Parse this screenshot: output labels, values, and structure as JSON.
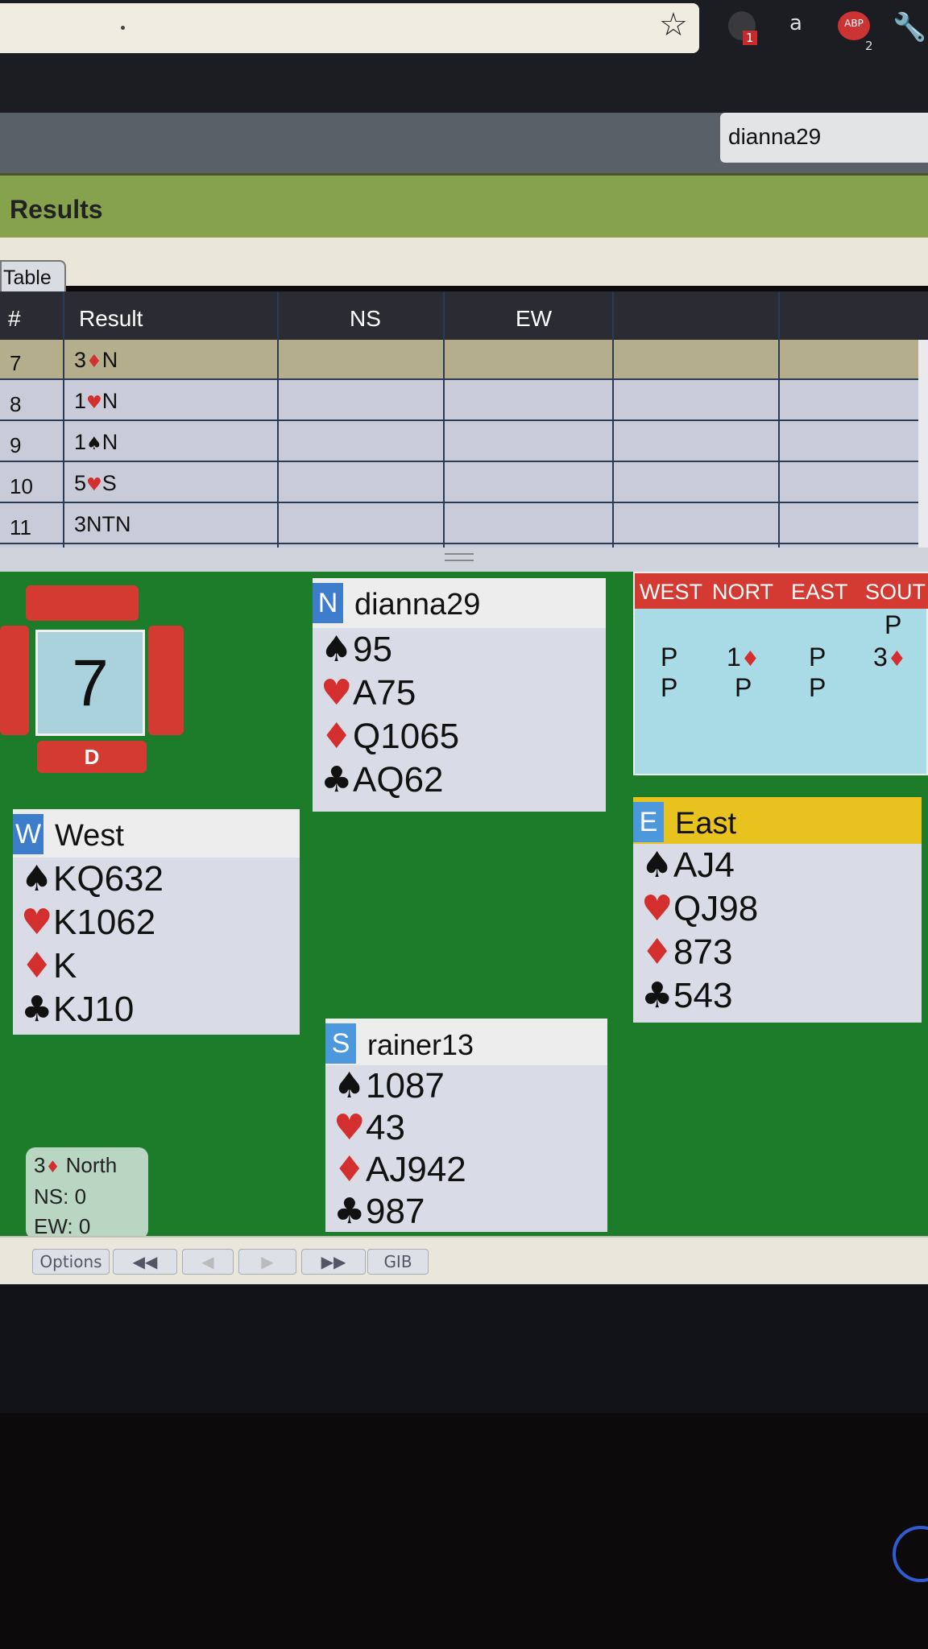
{
  "browser": {
    "bookmark_icon": "star-icon",
    "ext2_label": "a",
    "ext1_badge": "1",
    "ext3_label": "ABP",
    "ext3_count": "2"
  },
  "header": {
    "username": "dianna29",
    "section_title": "Results"
  },
  "tabs": [
    {
      "label": "Table"
    }
  ],
  "results": {
    "columns": [
      "#",
      "Result",
      "NS",
      "EW"
    ],
    "rows": [
      {
        "num": "7",
        "result": "3♦N"
      },
      {
        "num": "8",
        "result": "1♥N"
      },
      {
        "num": "9",
        "result": "1♠N"
      },
      {
        "num": "10",
        "result": "5♥S"
      },
      {
        "num": "11",
        "result": "3NTN"
      }
    ],
    "selected_row": "7"
  },
  "board": {
    "number": "7",
    "dealer": "D"
  },
  "hands": {
    "north": {
      "seat": "N",
      "name": "dianna29",
      "spades": "95",
      "hearts": "A75",
      "diamonds": "Q1065",
      "clubs": "AQ62"
    },
    "west": {
      "seat": "W",
      "name": "West",
      "spades": "KQ632",
      "hearts": "K1062",
      "diamonds": "K",
      "clubs": "KJ10"
    },
    "east": {
      "seat": "E",
      "name": "East",
      "spades": "AJ4",
      "hearts": "QJ98",
      "diamonds": "873",
      "clubs": "543"
    },
    "south": {
      "seat": "S",
      "name": "rainer13",
      "spades": "1087",
      "hearts": "43",
      "diamonds": "AJ942",
      "clubs": "987"
    }
  },
  "bidding": {
    "headers": [
      "WEST",
      "NORT",
      "EAST",
      "SOUT"
    ],
    "r1_south": "P",
    "r2_west": "P",
    "r2_north": "1",
    "r2_east": "P",
    "r2_south": "3",
    "r3_west": "P",
    "r3_north": "P",
    "r3_east": "P"
  },
  "score": {
    "contract": "3",
    "declarer": "North",
    "ns": "NS: 0",
    "ew": "EW: 0"
  },
  "toolbar": {
    "options": "Options",
    "rewind": "◀◀",
    "prev": "◀",
    "next": "▶",
    "forward": "▶▶",
    "gib": "GIB"
  },
  "colors": {
    "felt": "#1c7c2a",
    "accent_red": "#d33a32",
    "seat_blue": "#3d7dcc",
    "east_highlight": "#e8c21e",
    "bidding_bg": "#a8dbe6"
  }
}
